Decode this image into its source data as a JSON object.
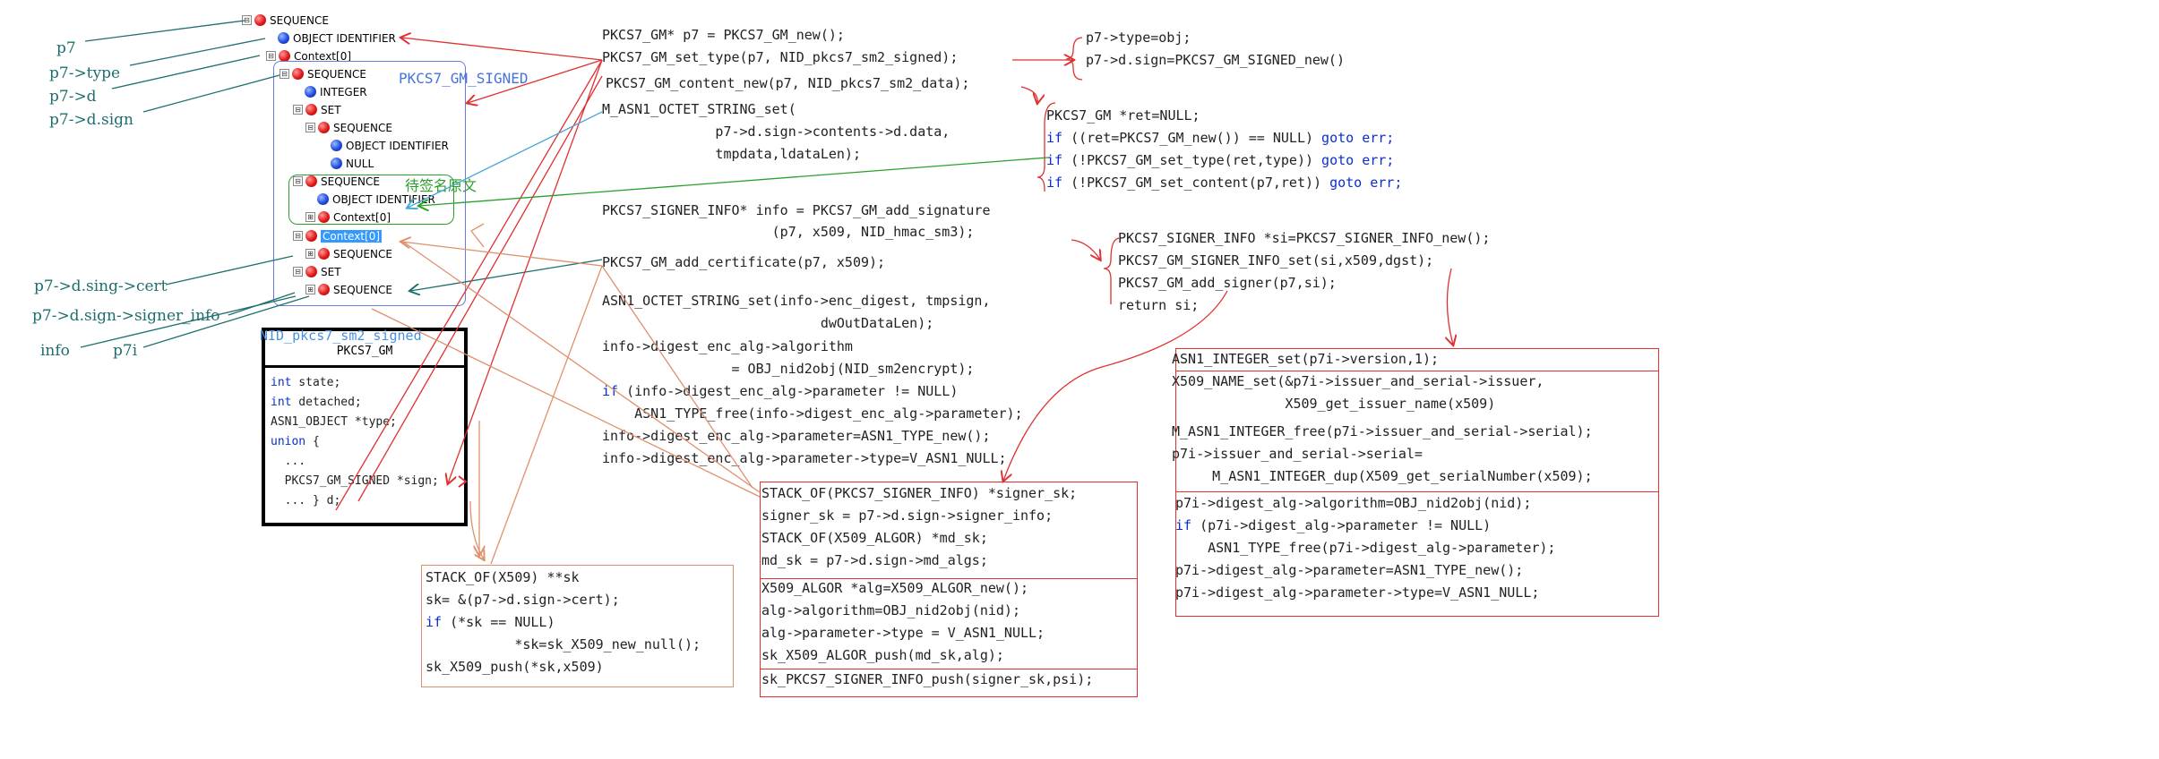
{
  "asn1_tree": [
    {
      "label": "SEQUENCE",
      "color": "red",
      "expander": "⊟"
    },
    {
      "label": "OBJECT IDENTIFIER",
      "color": "blue",
      "expander": ""
    },
    {
      "label": "Context[0]",
      "color": "red",
      "expander": "⊟"
    },
    {
      "label": "SEQUENCE",
      "color": "red",
      "expander": "⊟"
    },
    {
      "label": "INTEGER",
      "color": "blue",
      "expander": ""
    },
    {
      "label": "SET",
      "color": "red",
      "expander": "⊟"
    },
    {
      "label": "SEQUENCE",
      "color": "red",
      "expander": "⊟"
    },
    {
      "label": "OBJECT IDENTIFIER",
      "color": "blue",
      "expander": ""
    },
    {
      "label": "NULL",
      "color": "blue",
      "expander": ""
    },
    {
      "label": "SEQUENCE",
      "color": "red",
      "expander": "⊟"
    },
    {
      "label": "OBJECT IDENTIFIER",
      "color": "blue",
      "expander": ""
    },
    {
      "label": "Context[0]",
      "color": "red",
      "expander": "⊞"
    },
    {
      "label": "Context[0]",
      "color": "red",
      "expander": "⊟",
      "selected": true
    },
    {
      "label": "SEQUENCE",
      "color": "red",
      "expander": "⊞"
    },
    {
      "label": "SET",
      "color": "red",
      "expander": "⊟"
    },
    {
      "label": "SEQUENCE",
      "color": "red",
      "expander": "⊞"
    }
  ],
  "left_labels": {
    "p7": "p7",
    "p7_type": "p7->type",
    "p7_d": "p7->d",
    "p7_d_sign": "p7->d.sign",
    "p7_d_sing_cert": "p7->d.sing->cert",
    "p7_d_sign_signer_info": "p7->d.sign->signer_info",
    "info": "info",
    "p7i": "p7i"
  },
  "annotations": {
    "pkcs7_gm_signed": "PKCS7_GM_SIGNED",
    "to_be_signed": "待签名原文",
    "nid_signed": "NID_pkcs7_sm2_signed"
  },
  "struct_box": {
    "title": "PKCS7_GM",
    "lines": [
      {
        "kw": "int",
        "rest": " state;"
      },
      {
        "kw": "int",
        "rest": " detached;"
      },
      {
        "kw": "",
        "rest": "ASN1_OBJECT *type;"
      },
      {
        "kw": "union",
        "rest": " {"
      },
      {
        "kw": "",
        "rest": "  ..."
      },
      {
        "kw": "",
        "rest": "  PKCS7_GM_SIGNED *sign;"
      },
      {
        "kw": "",
        "rest": "  ... } d;"
      }
    ]
  },
  "main_code": [
    "PKCS7_GM* p7 = PKCS7_GM_new();",
    "PKCS7_GM_set_type(p7, NID_pkcs7_sm2_signed);",
    "PKCS7_GM_content_new(p7, NID_pkcs7_sm2_data);",
    "M_ASN1_OCTET_STRING_set(",
    "              p7->d.sign->contents->d.data,",
    "              tmpdata,ldataLen);",
    "PKCS7_SIGNER_INFO* info = PKCS7_GM_add_signature",
    "                     (p7, x509, NID_hmac_sm3);",
    "PKCS7_GM_add_certificate(p7, x509);",
    "ASN1_OCTET_STRING_set(info->enc_digest, tmpsign,",
    "                           dwOutDataLen);",
    "info->digest_enc_alg->algorithm",
    "                = OBJ_nid2obj(NID_sm2encrypt);",
    "if (info->digest_enc_alg->parameter != NULL)",
    "    ASN1_TYPE_free(info->digest_enc_alg->parameter);",
    "info->digest_enc_alg->parameter=ASN1_TYPE_new();",
    "info->digest_enc_alg->parameter->type=V_ASN1_NULL;"
  ],
  "set_type_code": [
    "p7->type=obj;",
    "p7->d.sign=PKCS7_GM_SIGNED_new()"
  ],
  "content_new_code": [
    {
      "kw": "",
      "rest": "PKCS7_GM *ret=NULL;",
      "tail": ""
    },
    {
      "kw": "if",
      "rest": " ((ret=PKCS7_GM_new()) == NULL) ",
      "tail": "goto err;"
    },
    {
      "kw": "if",
      "rest": " (!PKCS7_GM_set_type(ret,type)) ",
      "tail": "goto err;"
    },
    {
      "kw": "if",
      "rest": " (!PKCS7_GM_set_content(p7,ret)) ",
      "tail": "goto err;"
    }
  ],
  "add_signature_code": [
    "PKCS7_SIGNER_INFO *si=PKCS7_SIGNER_INFO_new();",
    "PKCS7_GM_SIGNER_INFO_set(si,x509,dgst);",
    "PKCS7_GM_add_signer(p7,si);",
    "return si;"
  ],
  "signer_info_set_code": {
    "group1": [
      "ASN1_INTEGER_set(p7i->version,1);"
    ],
    "group2": [
      "X509_NAME_set(&p7i->issuer_and_serial->issuer,",
      "              X509_get_issuer_name(x509)",
      "M_ASN1_INTEGER_free(p7i->issuer_and_serial->serial);",
      "p7i->issuer_and_serial->serial=",
      "     M_ASN1_INTEGER_dup(X509_get_serialNumber(x509);"
    ],
    "group3": [
      {
        "kw": "",
        "rest": "p7i->digest_alg->algorithm=OBJ_nid2obj(nid);"
      },
      {
        "kw": "if",
        "rest": " (p7i->digest_alg->parameter != NULL)"
      },
      {
        "kw": "",
        "rest": "    ASN1_TYPE_free(p7i->digest_alg->parameter);"
      },
      {
        "kw": "",
        "rest": "p7i->digest_alg->parameter=ASN1_TYPE_new();"
      },
      {
        "kw": "",
        "rest": "p7i->digest_alg->parameter->type=V_ASN1_NULL;"
      }
    ]
  },
  "add_signer_code": {
    "group1": [
      "STACK_OF(PKCS7_SIGNER_INFO) *signer_sk;",
      "signer_sk = p7->d.sign->signer_info;",
      "STACK_OF(X509_ALGOR) *md_sk;",
      "md_sk = p7->d.sign->md_algs;"
    ],
    "group2": [
      "X509_ALGOR *alg=X509_ALGOR_new();",
      "alg->algorithm=OBJ_nid2obj(nid);",
      "alg->parameter->type = V_ASN1_NULL;",
      "sk_X509_ALGOR_push(md_sk,alg);"
    ],
    "group3": [
      "sk_PKCS7_SIGNER_INFO_push(signer_sk,psi);"
    ]
  },
  "add_certificate_code": [
    {
      "kw": "",
      "rest": "STACK_OF(X509) **sk"
    },
    {
      "kw": "",
      "rest": "sk= &(p7->d.sign->cert);"
    },
    {
      "kw": "if",
      "rest": " (*sk == NULL)"
    },
    {
      "kw": "",
      "rest": "           *sk=sk_X509_new_null();"
    },
    {
      "kw": "",
      "rest": "sk_X509_push(*sk,x509)"
    }
  ],
  "colors": {
    "red": "#e03030",
    "orange": "#e0906a",
    "teal": "#1e6f6f",
    "blue": "#4472e0",
    "green": "#2aa02a",
    "keyword": "#0a2fd0"
  }
}
